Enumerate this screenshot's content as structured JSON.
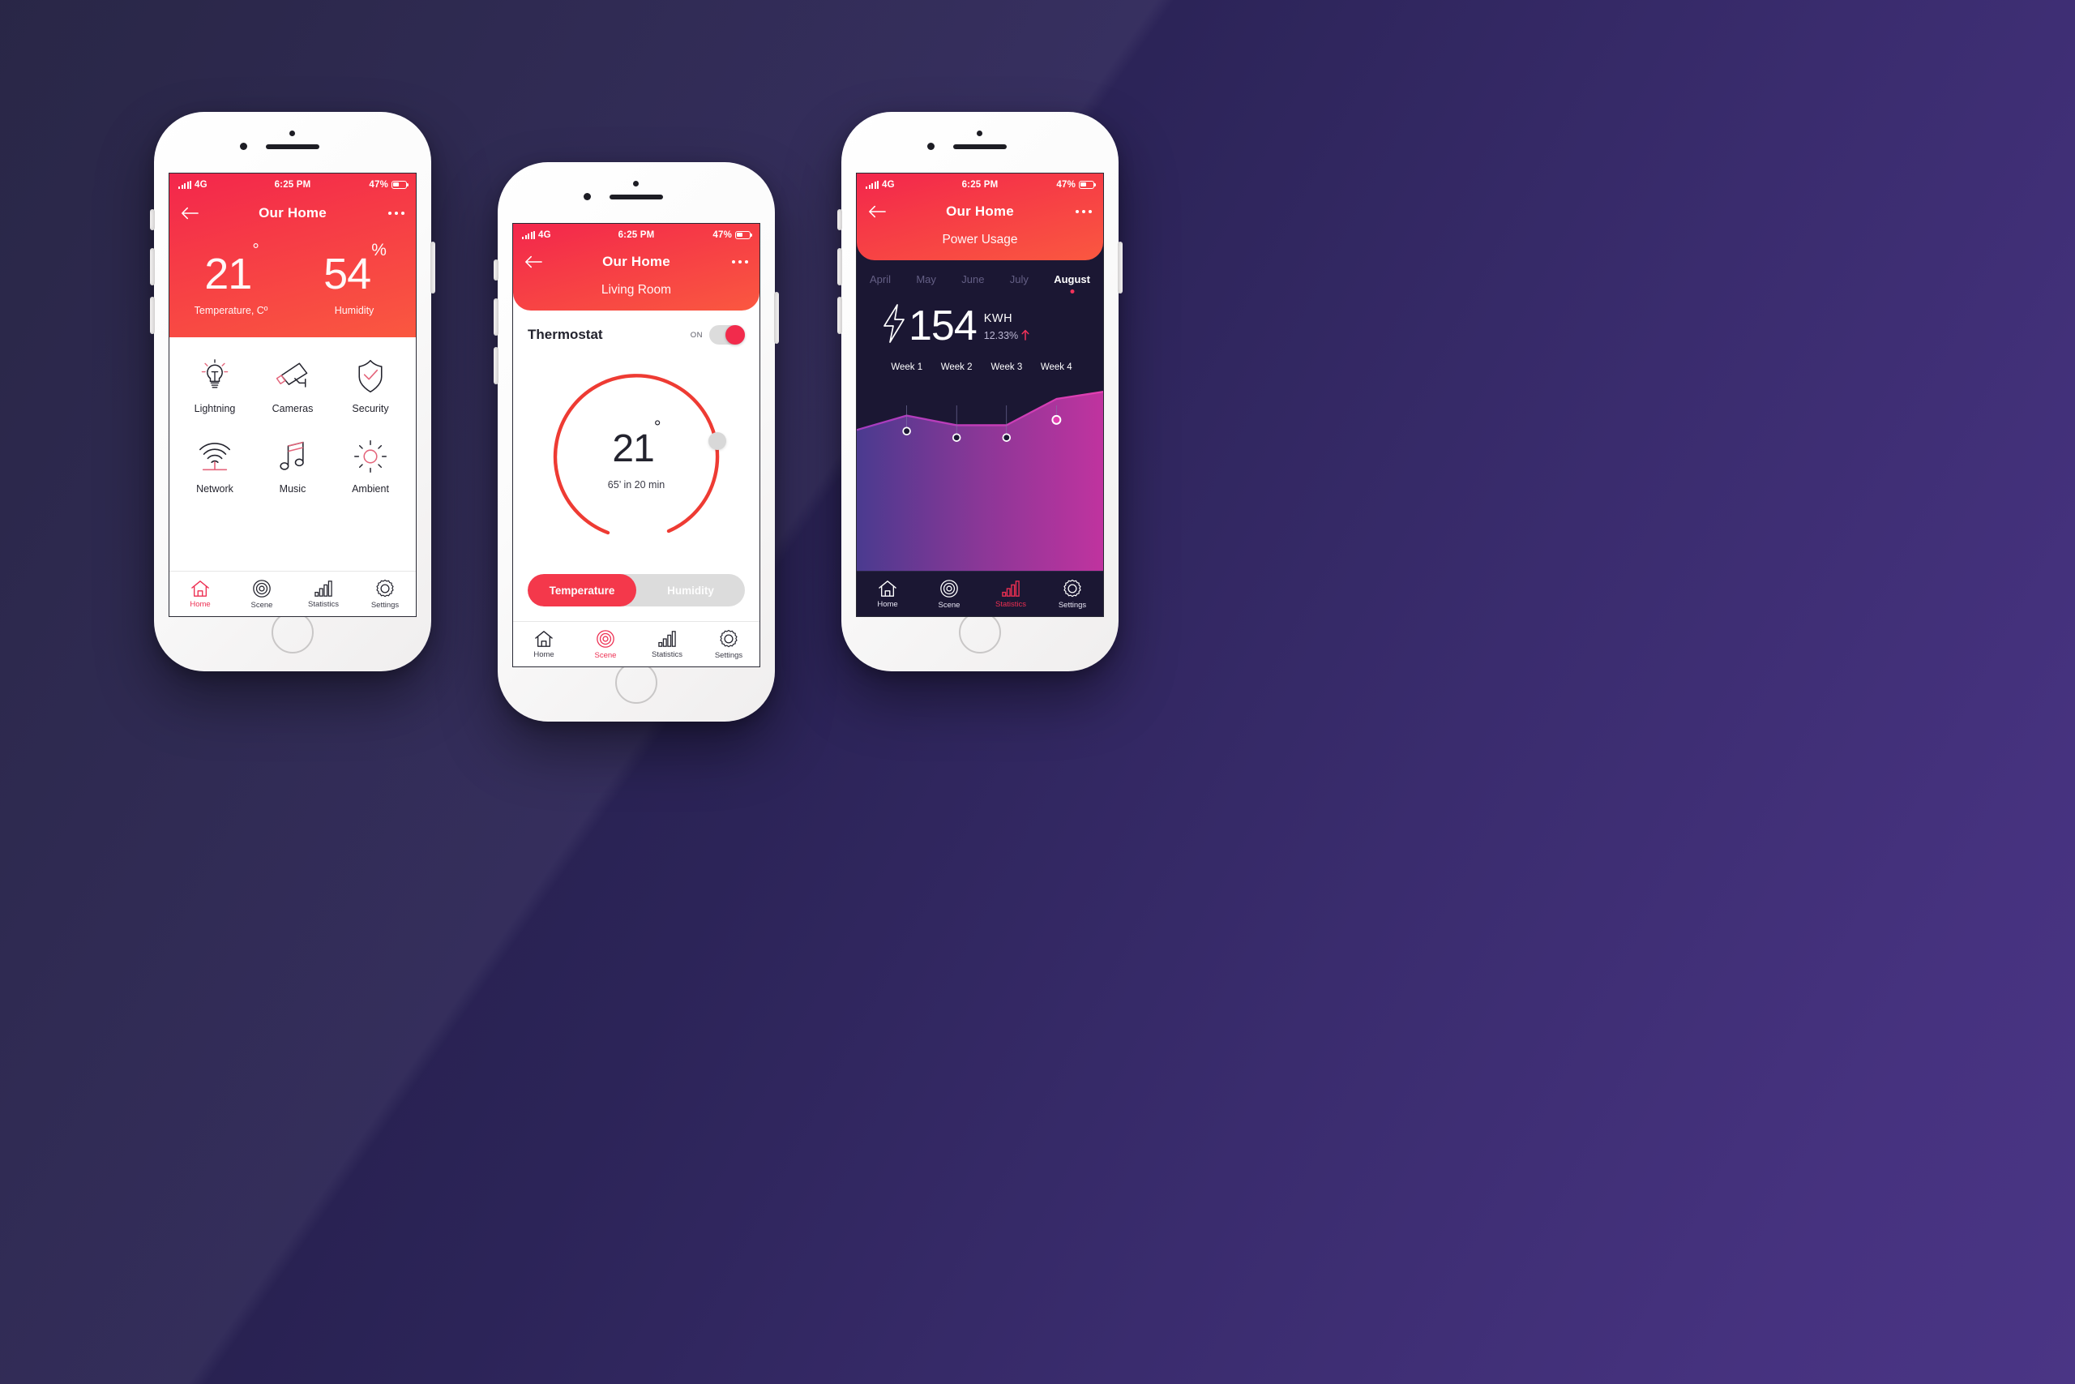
{
  "status_bar": {
    "network": "4G",
    "time": "6:25 PM",
    "battery": "47%"
  },
  "colors": {
    "accent_red": "#F2325A",
    "header_top": "#F3264C",
    "header_bottom": "#FA5840",
    "dark_bg": "#1b1733",
    "chart_left": "#4a3a8f",
    "chart_right": "#c0339f"
  },
  "phone1": {
    "nav": {
      "title": "Our Home",
      "back_icon": "back-arrow-icon",
      "menu_icon": "more-dots-icon"
    },
    "hero": [
      {
        "value": "21",
        "unit": "°",
        "label": "Temperature, Cº"
      },
      {
        "value": "54",
        "unit": "%",
        "label": "Humidity"
      }
    ],
    "tiles": [
      {
        "label": "Lightning",
        "icon": "lightbulb-icon"
      },
      {
        "label": "Cameras",
        "icon": "security-camera-icon"
      },
      {
        "label": "Security",
        "icon": "shield-check-icon"
      },
      {
        "label": "Network",
        "icon": "wifi-icon"
      },
      {
        "label": "Music",
        "icon": "music-notes-icon"
      },
      {
        "label": "Ambient",
        "icon": "sun-icon"
      }
    ],
    "tabs": [
      {
        "label": "Home",
        "icon": "home-icon",
        "active": true
      },
      {
        "label": "Scene",
        "icon": "scene-target-icon",
        "active": false
      },
      {
        "label": "Statistics",
        "icon": "bar-chart-icon",
        "active": false
      },
      {
        "label": "Settings",
        "icon": "gear-icon",
        "active": false
      }
    ]
  },
  "phone2": {
    "nav": {
      "title": "Our Home",
      "subtitle": "Living Room"
    },
    "thermostat": {
      "title": "Thermostat",
      "toggle_label": "ON",
      "toggle_on": true,
      "temperature": "21",
      "degree": "°",
      "schedule": "65’ in 20 min"
    },
    "segmented": [
      {
        "label": "Temperature",
        "active": true
      },
      {
        "label": "Humidity",
        "active": false
      }
    ],
    "tabs": [
      {
        "label": "Home",
        "icon": "home-icon",
        "active": false
      },
      {
        "label": "Scene",
        "icon": "scene-target-icon",
        "active": true
      },
      {
        "label": "Statistics",
        "icon": "bar-chart-icon",
        "active": false
      },
      {
        "label": "Settings",
        "icon": "gear-icon",
        "active": false
      }
    ]
  },
  "phone3": {
    "nav": {
      "title": "Our Home",
      "subtitle": "Power Usage"
    },
    "months": [
      {
        "label": "April",
        "active": false
      },
      {
        "label": "May",
        "active": false
      },
      {
        "label": "June",
        "active": false
      },
      {
        "label": "July",
        "active": false
      },
      {
        "label": "August",
        "active": true
      }
    ],
    "usage": {
      "value": "154",
      "unit": "KWH",
      "delta": "12.33%",
      "delta_direction": "up",
      "bolt_icon": "lightning-bolt-icon"
    },
    "tabs": [
      {
        "label": "Home",
        "icon": "home-icon",
        "active": false
      },
      {
        "label": "Scene",
        "icon": "scene-target-icon",
        "active": false
      },
      {
        "label": "Statistics",
        "icon": "bar-chart-icon",
        "active": true
      },
      {
        "label": "Settings",
        "icon": "gear-icon",
        "active": false
      }
    ]
  },
  "chart_data": {
    "type": "area",
    "title": "Power Usage",
    "categories": [
      "Week 1",
      "Week 2",
      "Week 3",
      "Week 4"
    ],
    "values": [
      118,
      108,
      108,
      142
    ],
    "xlabel": "",
    "ylabel": "KWH",
    "ylim": [
      0,
      170
    ],
    "grid": false,
    "legend": "none",
    "highlight_index": 3,
    "series": [
      {
        "name": "KWH",
        "values": [
          118,
          108,
          108,
          142
        ]
      }
    ]
  }
}
